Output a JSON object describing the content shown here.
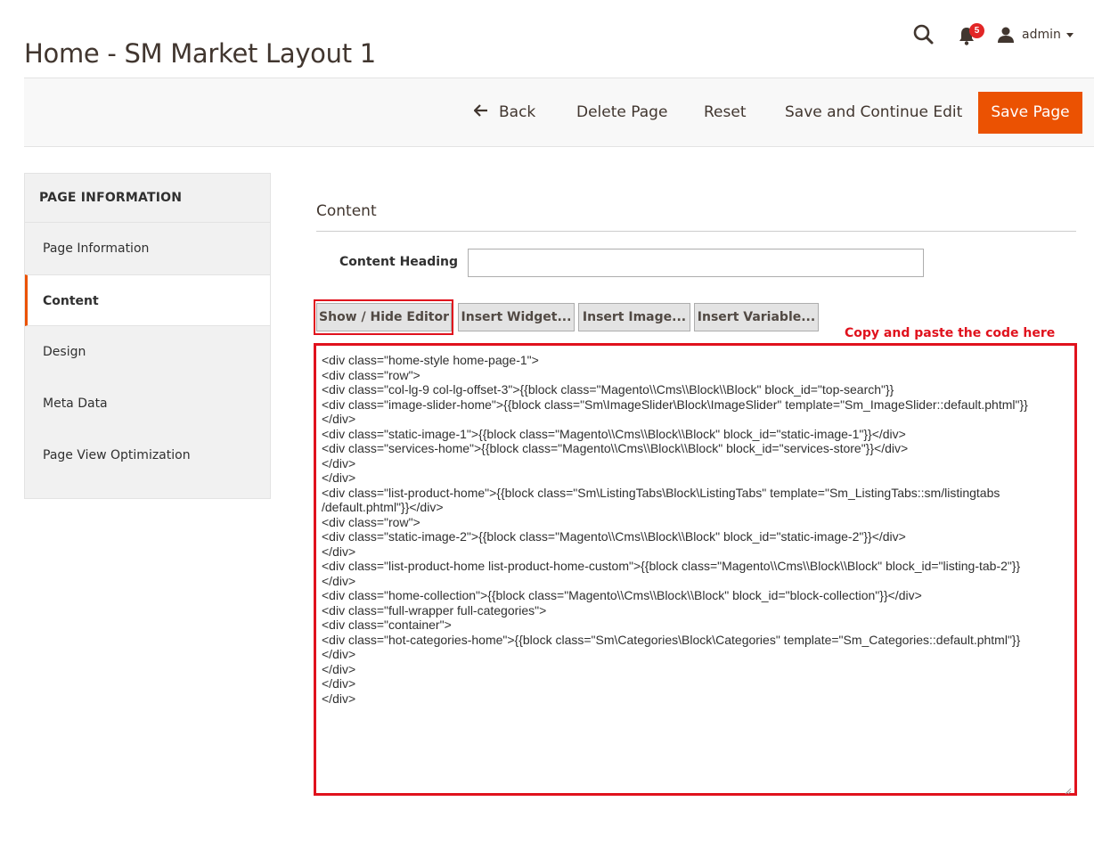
{
  "page_title": "Home - SM Market Layout 1",
  "header": {
    "notifications_count": "5",
    "user_name": "admin",
    "icons": {
      "search": "search-icon",
      "notifications": "bell-icon",
      "user": "user-icon"
    }
  },
  "actions": {
    "back": "Back",
    "delete": "Delete Page",
    "reset": "Reset",
    "save_continue": "Save and Continue Edit",
    "save": "Save Page"
  },
  "sidebar": {
    "heading": "PAGE INFORMATION",
    "items": [
      {
        "label": "Page Information"
      },
      {
        "label": "Content",
        "active": true
      },
      {
        "label": "Design"
      },
      {
        "label": "Meta Data"
      },
      {
        "label": "Page View Optimization"
      }
    ]
  },
  "content": {
    "section_title": "Content",
    "heading_label": "Content Heading",
    "heading_value": "",
    "buttons": {
      "show_hide": "Show / Hide Editor",
      "insert_widget": "Insert Widget...",
      "insert_image": "Insert Image...",
      "insert_variable": "Insert Variable..."
    },
    "annotation": "Copy and paste the code here",
    "code": "<div class=\"home-style home-page-1\">\n<div class=\"row\">\n<div class=\"col-lg-9 col-lg-offset-3\">{{block class=\"Magento\\\\Cms\\\\Block\\\\Block\" block_id=\"top-search\"}}\n<div class=\"image-slider-home\">{{block class=\"Sm\\ImageSlider\\Block\\ImageSlider\" template=\"Sm_ImageSlider::default.phtml\"}}\n</div>\n<div class=\"static-image-1\">{{block class=\"Magento\\\\Cms\\\\Block\\\\Block\" block_id=\"static-image-1\"}}</div>\n<div class=\"services-home\">{{block class=\"Magento\\\\Cms\\\\Block\\\\Block\" block_id=\"services-store\"}}</div>\n</div>\n</div>\n<div class=\"list-product-home\">{{block class=\"Sm\\ListingTabs\\Block\\ListingTabs\" template=\"Sm_ListingTabs::sm/listingtabs\n/default.phtml\"}}</div>\n<div class=\"row\">\n<div class=\"static-image-2\">{{block class=\"Magento\\\\Cms\\\\Block\\\\Block\" block_id=\"static-image-2\"}}</div>\n</div>\n<div class=\"list-product-home list-product-home-custom\">{{block class=\"Magento\\\\Cms\\\\Block\\\\Block\" block_id=\"listing-tab-2\"}}\n</div>\n<div class=\"home-collection\">{{block class=\"Magento\\\\Cms\\\\Block\\\\Block\" block_id=\"block-collection\"}}</div>\n<div class=\"full-wrapper full-categories\">\n<div class=\"container\">\n<div class=\"hot-categories-home\">{{block class=\"Sm\\Categories\\Block\\Categories\" template=\"Sm_Categories::default.phtml\"}}\n</div>\n</div>\n</div>\n</div>"
  },
  "colors": {
    "accent": "#eb5202",
    "annotation_red": "#e0121d",
    "badge_red": "#e22626"
  }
}
